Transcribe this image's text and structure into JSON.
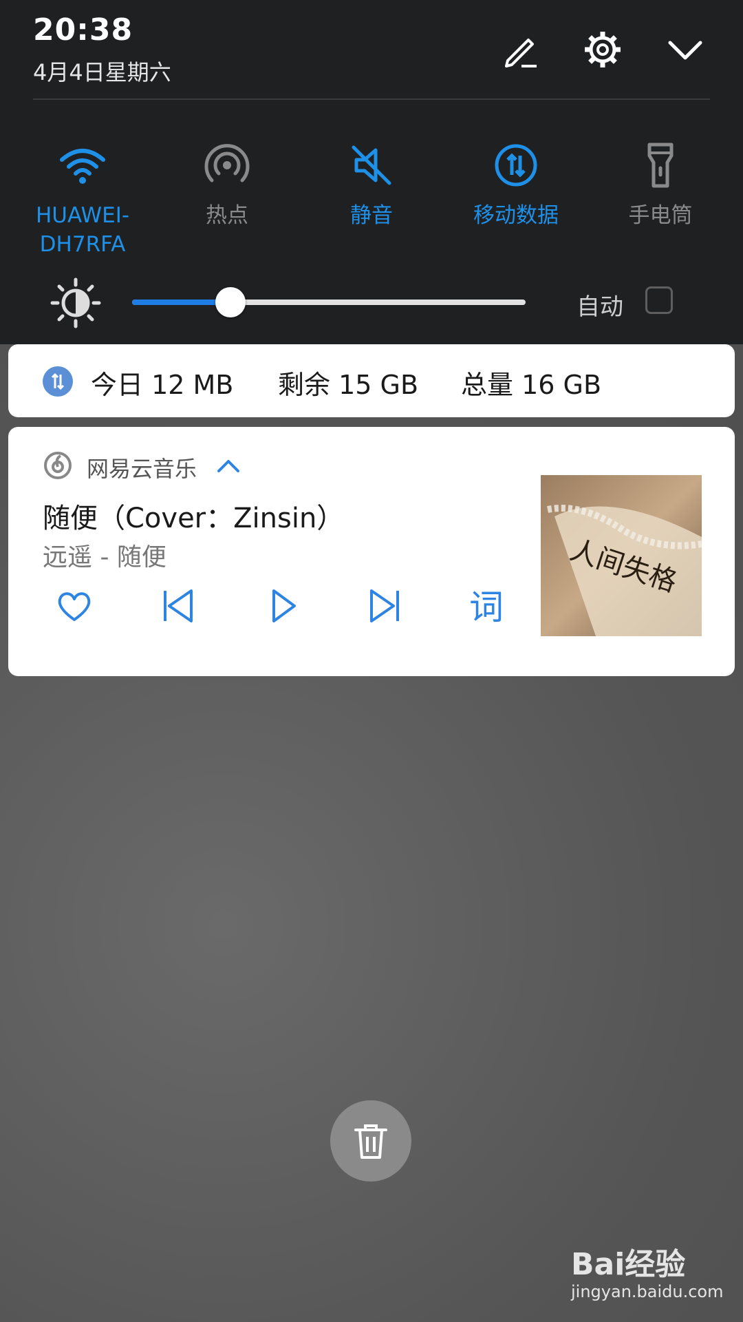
{
  "status": {
    "time": "20:38",
    "date": "4月4日星期六"
  },
  "tiles": [
    {
      "label": "HUAWEI-\nDH7RFA",
      "icon": "wifi-icon",
      "state": "on"
    },
    {
      "label": "热点",
      "icon": "hotspot-icon",
      "state": "off"
    },
    {
      "label": "静音",
      "icon": "mute-icon",
      "state": "on"
    },
    {
      "label": "移动数据",
      "icon": "mobile-data-icon",
      "state": "on"
    },
    {
      "label": "手电筒",
      "icon": "flashlight-icon",
      "state": "off"
    }
  ],
  "brightness": {
    "level": 0.25,
    "auto_label": "自动",
    "auto_checked": false
  },
  "data_usage": {
    "today": "今日 12 MB",
    "remaining": "剩余 15 GB",
    "total": "总量 16 GB"
  },
  "music": {
    "app_name": "网易云音乐",
    "song": "随便（Cover：Zinsin）",
    "artist_album": "远遥 - 随便",
    "lyric_label": "词",
    "cover_text": "人间失格"
  },
  "watermark": {
    "logo": "Bai经验",
    "url": "jingyan.baidu.com"
  },
  "colors": {
    "accent": "#1e90e8",
    "inactive": "#8a8a8a",
    "panel": "#1f2022"
  }
}
